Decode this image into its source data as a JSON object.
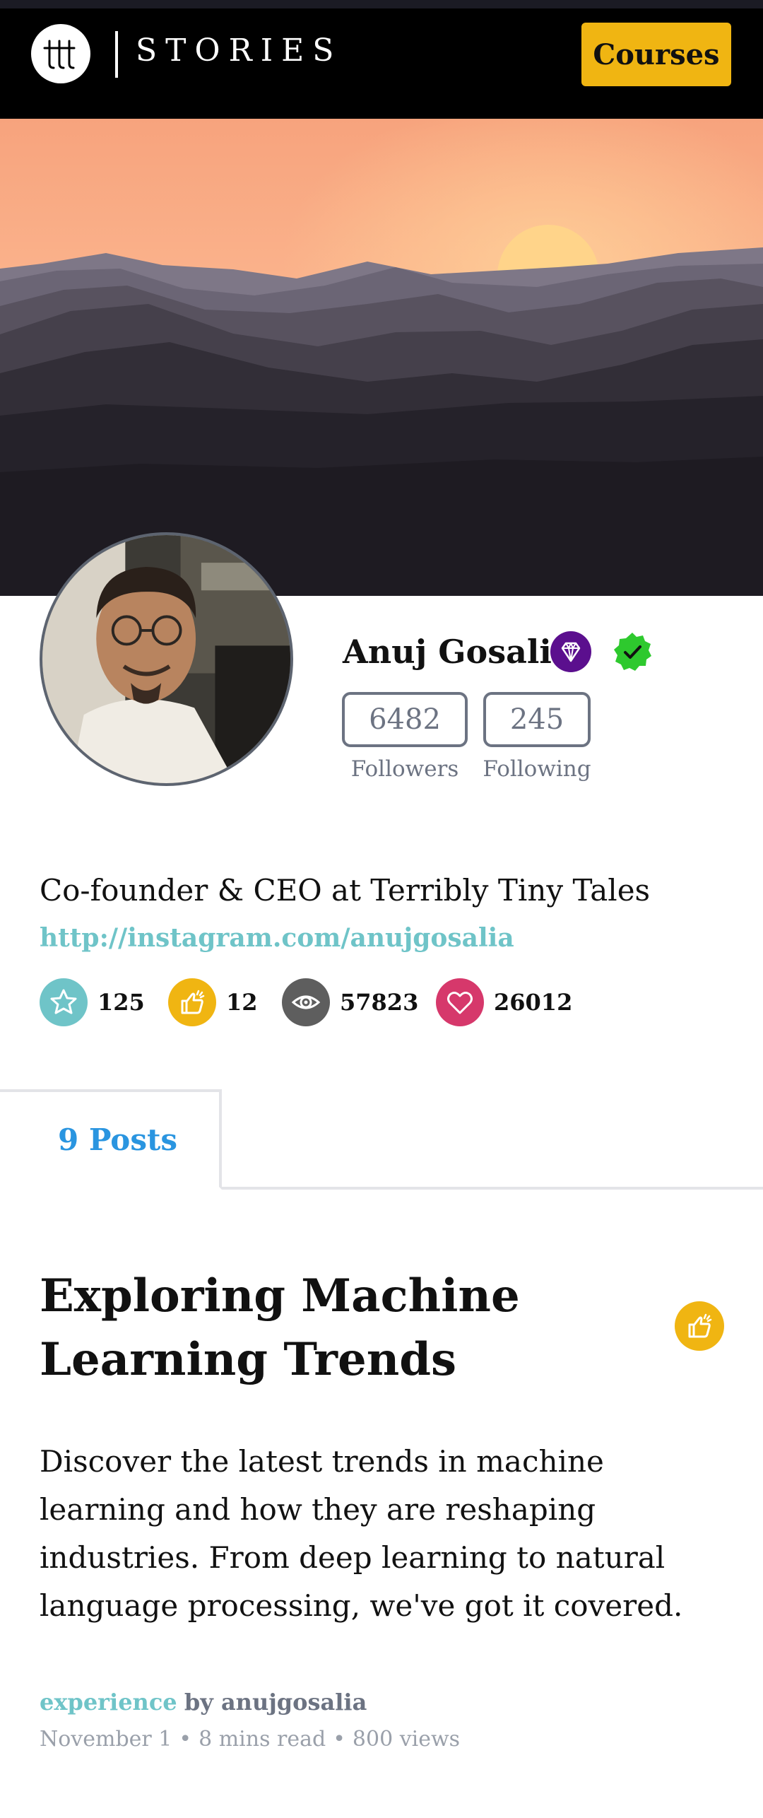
{
  "header": {
    "brand": "STORIES",
    "courses_label": "Courses",
    "logo_icon": "ttt-logo-icon"
  },
  "profile": {
    "name": "Anuj Gosalia",
    "followers_count": "6482",
    "followers_label": "Followers",
    "following_count": "245",
    "following_label": "Following",
    "bio": "Co-founder & CEO at Terribly Tiny Tales",
    "link": "http://instagram.com/anujgosalia",
    "badges": [
      "diamond-badge-icon",
      "verified-badge-icon"
    ]
  },
  "stats": [
    {
      "icon": "star-icon",
      "value": "125",
      "color": "#6fc4c8"
    },
    {
      "icon": "thumbs-up-icon",
      "value": "12",
      "color": "#f0b512"
    },
    {
      "icon": "eye-icon",
      "value": "57823",
      "color": "#5e5e5e"
    },
    {
      "icon": "heart-icon",
      "value": "26012",
      "color": "#d6386b"
    }
  ],
  "tabs": {
    "active_label": "9 Posts"
  },
  "post": {
    "title": "Exploring Machine Learning Trends",
    "excerpt": "Discover the latest trends in machine learning and how they are reshaping industries. From deep learning to natural language processing, we've got it covered.",
    "tag": "experience",
    "by": "by anujgosalia",
    "date": "November 1",
    "read_time": "8 mins read",
    "views": "800 views"
  },
  "colors": {
    "accent_yellow": "#f0b512",
    "link_teal": "#6fc4c8",
    "tab_blue": "#2a95e0",
    "muted_gray": "#6c7382"
  }
}
